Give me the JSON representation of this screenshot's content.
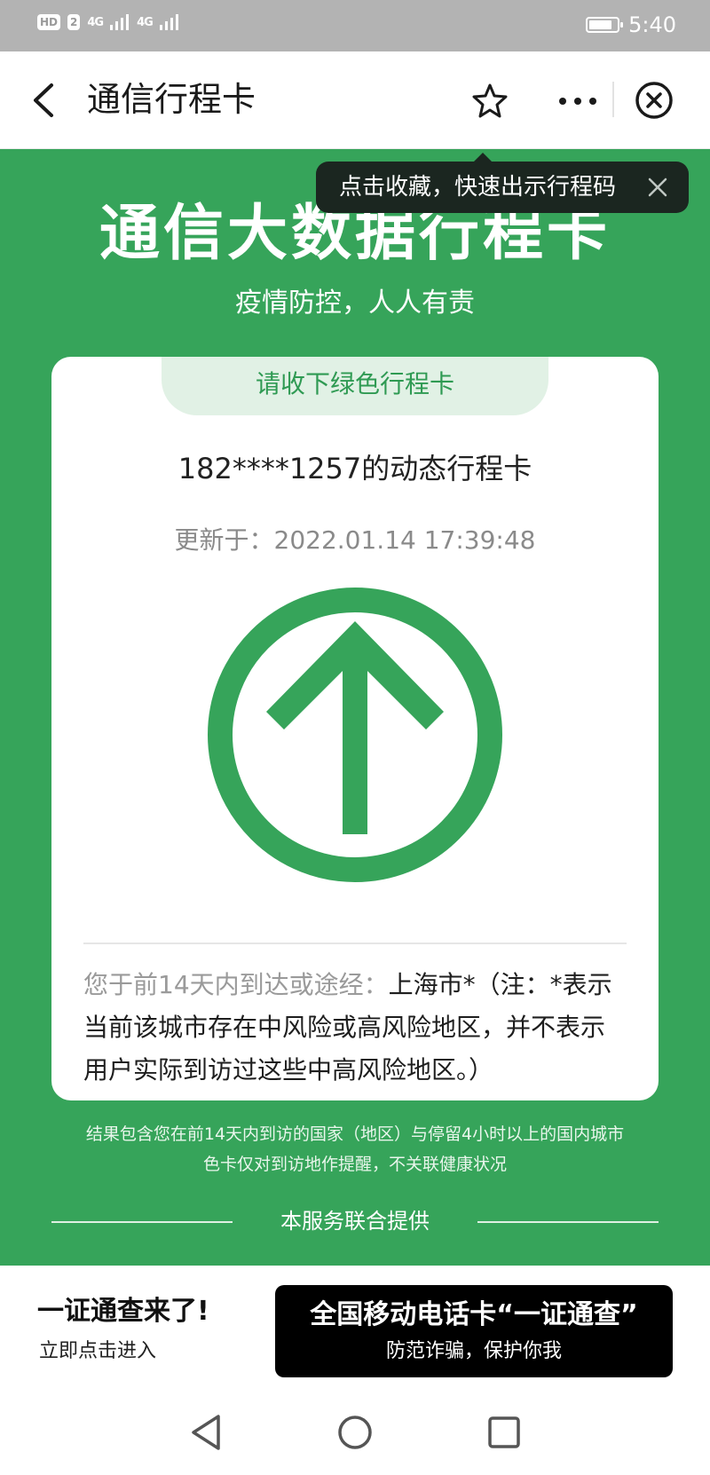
{
  "status_bar": {
    "hd_badge": "HD",
    "sim_slot": "2",
    "signal_1": "4G",
    "signal_2": "4G",
    "time": "5:40"
  },
  "nav": {
    "title": "通信行程卡",
    "icons": [
      "back-arrow-icon",
      "star-icon",
      "more-dots-icon",
      "close-circle-icon"
    ]
  },
  "tooltip": {
    "text": "点击收藏，快速出示行程码"
  },
  "hero": {
    "title": "通信大数据行程卡",
    "subtitle": "疫情防控，人人有责"
  },
  "card": {
    "tab_label": "请收下绿色行程卡",
    "phone_line": "182****1257的动态行程卡",
    "update_label": "更新于：",
    "update_time": "2022.01.14 17:39:48",
    "note_label": "您于前14天内到达或途经：",
    "note_value": "上海市*（注：*表示当前该城市存在中风险或高风险地区，并不表示用户实际到访过这些中高风险地区。）",
    "status_color": "#36a45a"
  },
  "footer": {
    "line1": "结果包含您在前14天内到访的国家（地区）与停留4小时以上的国内城市",
    "line2": "色卡仅对到访地作提醒，不关联健康状况",
    "provider": "本服务联合提供"
  },
  "promo": {
    "title": "一证通查来了!",
    "subtitle": "立即点击进入",
    "button_title": "全国移动电话卡“一证通查”",
    "button_subtitle": "防范诈骗，保护你我"
  },
  "colors": {
    "primary_green": "#36a45a",
    "tab_bg": "#e1f1e5",
    "tooltip_bg": "#1b2620"
  }
}
